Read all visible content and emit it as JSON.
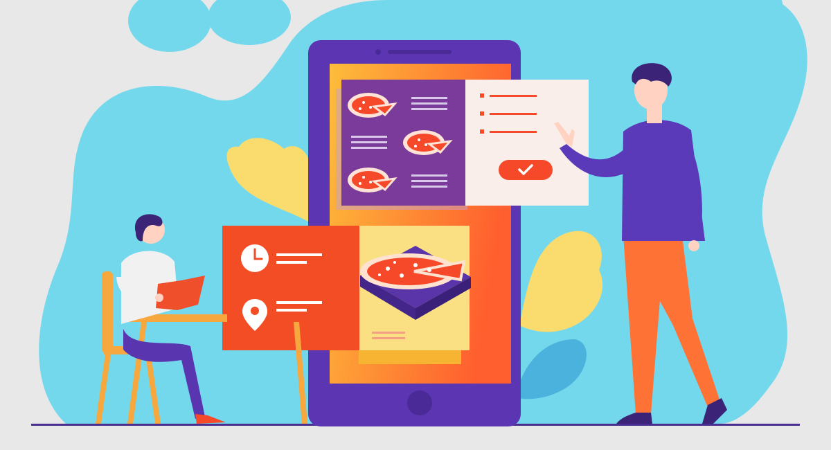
{
  "colors": {
    "background": "#e8e8e8",
    "blob": "#74d8ec",
    "leaf": "#fadc6e",
    "leaf_blue": "#4ab2dc",
    "phone_frame": "#5b35b2",
    "phone_frame_dark": "#4a2a96",
    "screen_top": "#fdbd3b",
    "screen_bottom": "#ff6a2a",
    "menu_panel": "#7a3b9a",
    "order_panel": "#faeeea",
    "accent_red": "#f5492a",
    "info_panel": "#f24d25",
    "pizza_card": "#fadf83",
    "pizza_box": "#5a35a9",
    "ground": "#4a2e8f",
    "man_shirt": "#5a3ab8",
    "man_pants": "#ff7235",
    "skin": "#ffd2c2",
    "hair": "#3b2478",
    "woman_shirt": "#f1f1f1",
    "woman_pants": "#5a35b0",
    "chair": "#f6a83e",
    "table": "#f6a83e",
    "menu_book": "#ef4f2a"
  },
  "icons": {
    "clock": "clock-icon",
    "location": "location-pin-icon",
    "check": "checkmark-icon",
    "home_button": "home-button-icon"
  }
}
